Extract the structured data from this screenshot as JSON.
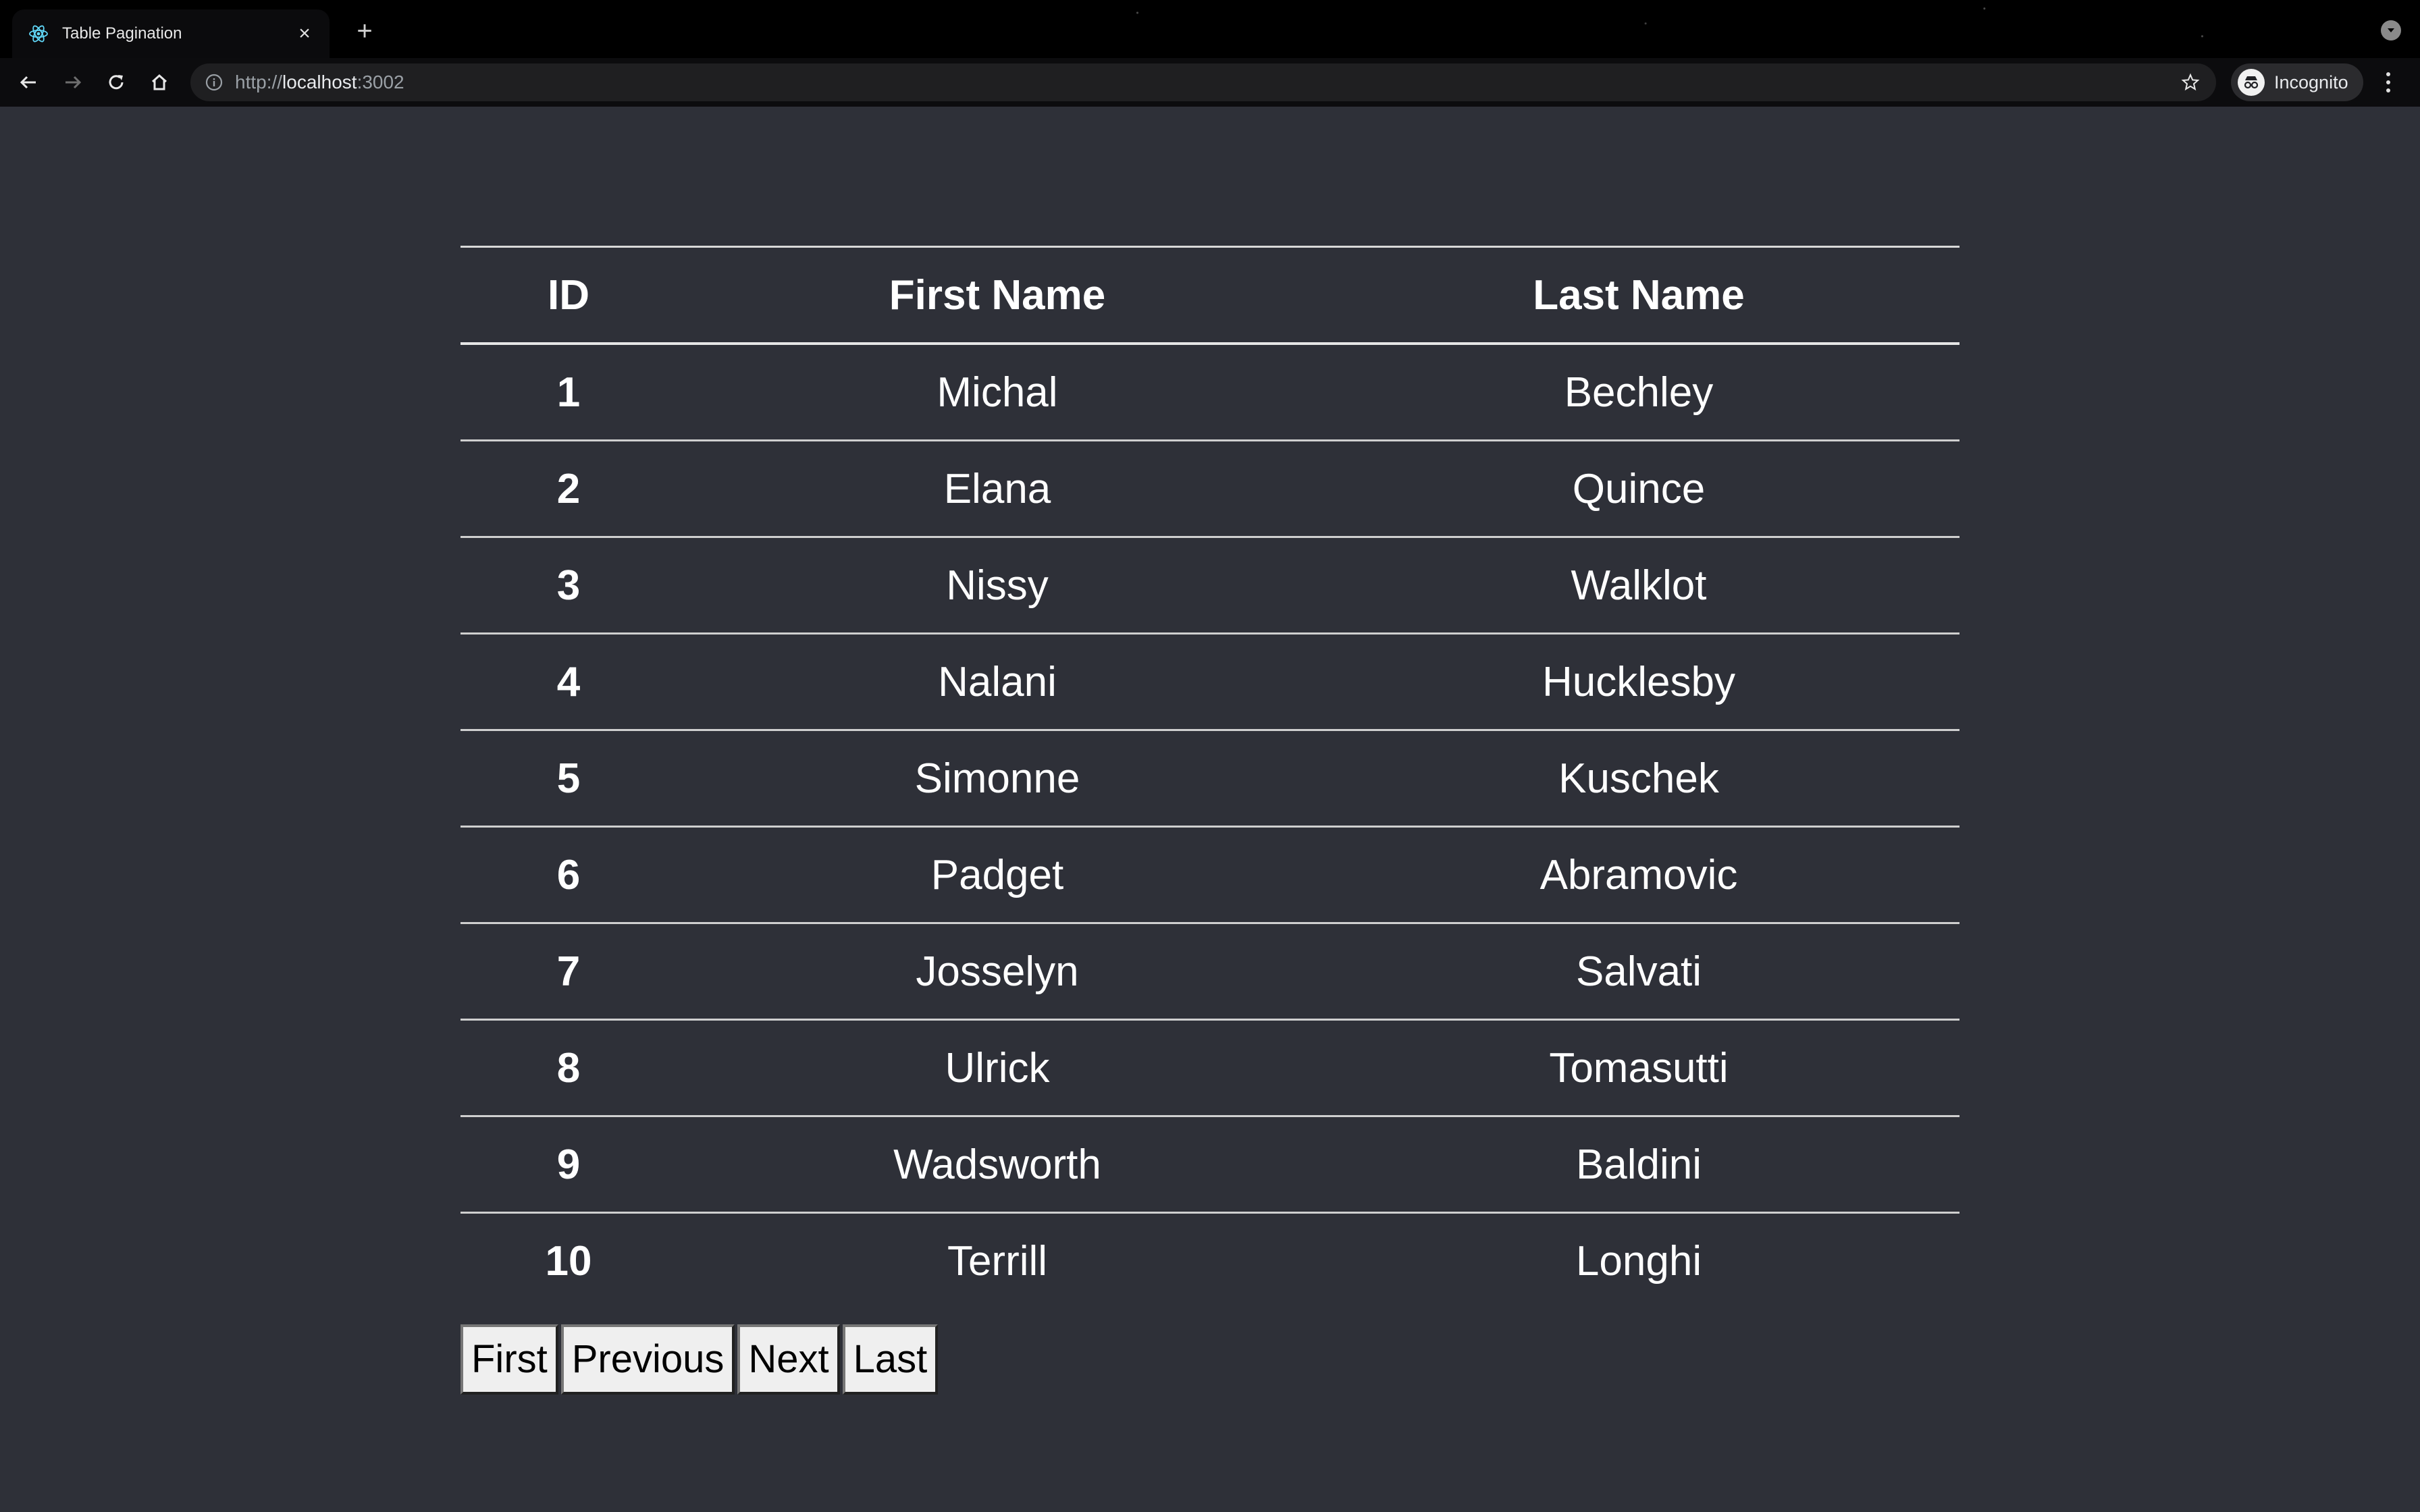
{
  "browser": {
    "tab_title": "Table Pagination",
    "tab_close": "×",
    "new_tab": "+",
    "url_scheme": "http://",
    "url_host": "localhost",
    "url_port": ":3002",
    "profile_label": "Incognito",
    "icons": {
      "favicon": "react-atom-icon",
      "back": "back-arrow-icon",
      "forward": "forward-arrow-icon",
      "reload": "reload-icon",
      "home": "home-icon",
      "site_info": "info-icon",
      "bookmark": "star-icon",
      "menu": "kebab-menu-icon"
    }
  },
  "table": {
    "headers": {
      "id": "ID",
      "first_name": "First Name",
      "last_name": "Last Name"
    },
    "rows": [
      {
        "id": "1",
        "first": "Michal",
        "last": "Bechley"
      },
      {
        "id": "2",
        "first": "Elana",
        "last": "Quince"
      },
      {
        "id": "3",
        "first": "Nissy",
        "last": "Walklot"
      },
      {
        "id": "4",
        "first": "Nalani",
        "last": "Hucklesby"
      },
      {
        "id": "5",
        "first": "Simonne",
        "last": "Kuschek"
      },
      {
        "id": "6",
        "first": "Padget",
        "last": "Abramovic"
      },
      {
        "id": "7",
        "first": "Josselyn",
        "last": "Salvati"
      },
      {
        "id": "8",
        "first": "Ulrick",
        "last": "Tomasutti"
      },
      {
        "id": "9",
        "first": "Wadsworth",
        "last": "Baldini"
      },
      {
        "id": "10",
        "first": "Terrill",
        "last": "Longhi"
      }
    ]
  },
  "pagination": {
    "first": "First",
    "previous": "Previous",
    "next": "Next",
    "last": "Last"
  },
  "colors": {
    "page_background": "#2e3038",
    "text": "#ffffff",
    "chrome_background": "#000000"
  }
}
